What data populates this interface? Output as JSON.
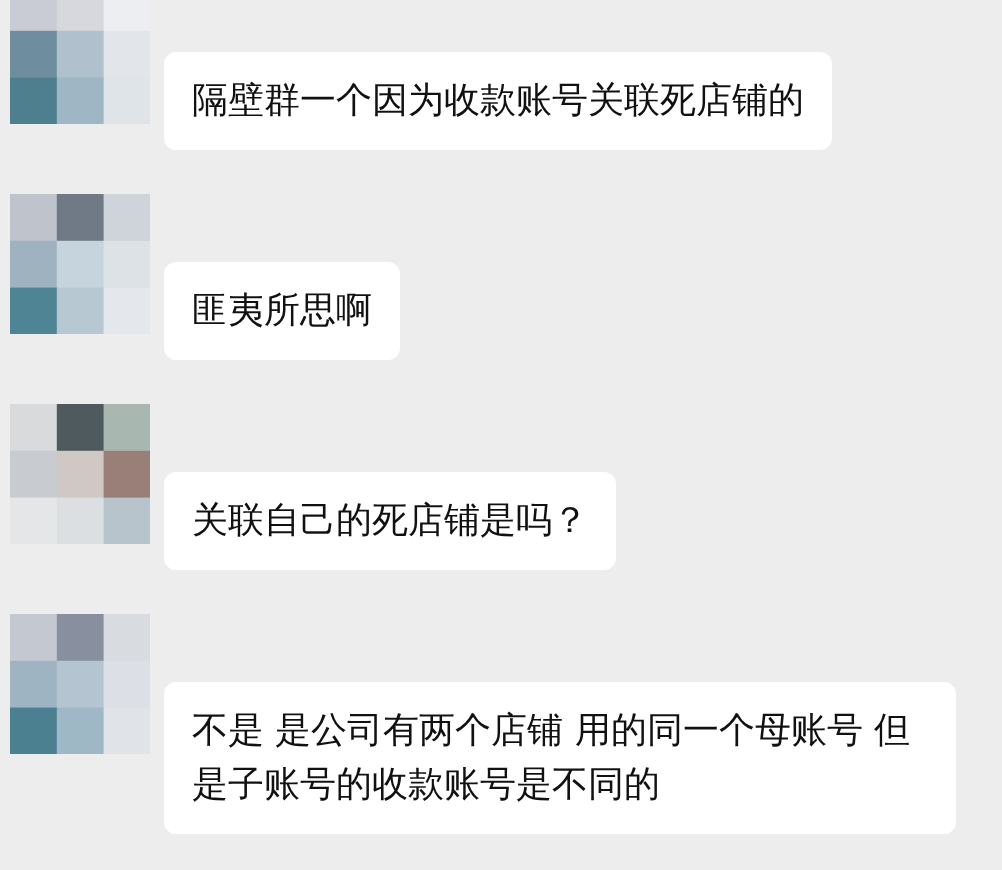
{
  "messages": [
    {
      "text": "隔壁群一个因为收款账号关联死店铺的"
    },
    {
      "text": "匪夷所思啊"
    },
    {
      "text": "关联自己的死店铺是吗？"
    },
    {
      "text": "不是 是公司有两个店铺 用的同一个母账号 但是子账号的收款账号是不同的"
    }
  ]
}
